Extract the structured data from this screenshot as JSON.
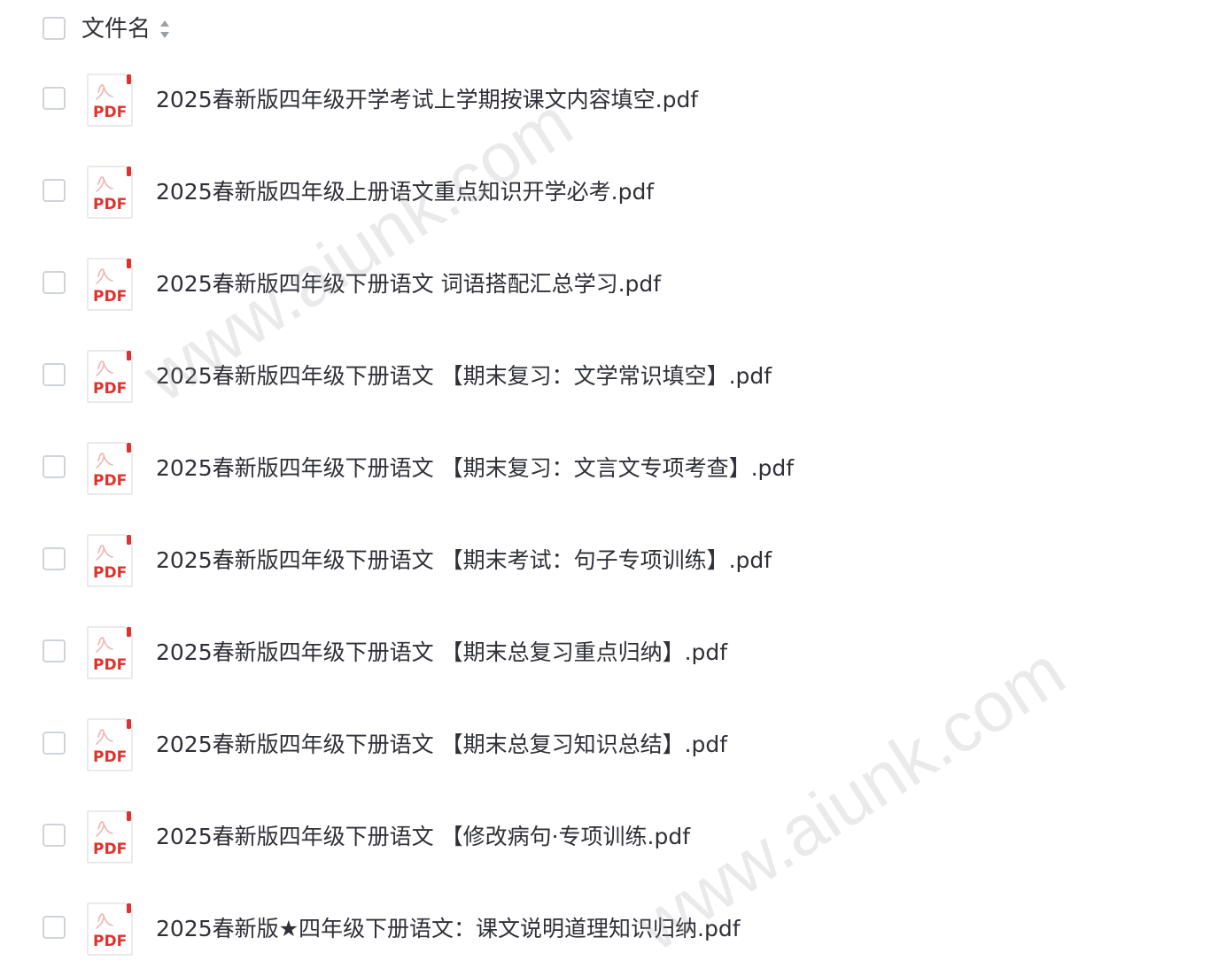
{
  "header": {
    "label": "文件名"
  },
  "files": [
    {
      "name": "2025春新版四年级开学考试上学期按课文内容填空.pdf",
      "badge": "PDF"
    },
    {
      "name": "2025春新版四年级上册语文重点知识开学必考.pdf",
      "badge": "PDF"
    },
    {
      "name": "2025春新版四年级下册语文 词语搭配汇总学习.pdf",
      "badge": "PDF"
    },
    {
      "name": "2025春新版四年级下册语文 【期末复习：文学常识填空】.pdf",
      "badge": "PDF"
    },
    {
      "name": "2025春新版四年级下册语文 【期末复习：文言文专项考查】.pdf",
      "badge": "PDF"
    },
    {
      "name": "2025春新版四年级下册语文 【期末考试：句子专项训练】.pdf",
      "badge": "PDF"
    },
    {
      "name": "2025春新版四年级下册语文 【期末总复习重点归纳】.pdf",
      "badge": "PDF"
    },
    {
      "name": "2025春新版四年级下册语文 【期末总复习知识总结】.pdf",
      "badge": "PDF"
    },
    {
      "name": "2025春新版四年级下册语文 【修改病句·专项训练.pdf",
      "badge": "PDF"
    },
    {
      "name": "2025春新版★四年级下册语文：课文说明道理知识归纳.pdf",
      "badge": "PDF"
    }
  ],
  "watermarks": [
    "www.aiunk.com",
    "www.aiunk.com"
  ],
  "colors": {
    "pdf_red": "#e0322d",
    "text": "#2f3038",
    "checkbox_border": "#cfd3da"
  },
  "icons": {
    "sort": "sort-icon",
    "file": "pdf-file-icon"
  }
}
